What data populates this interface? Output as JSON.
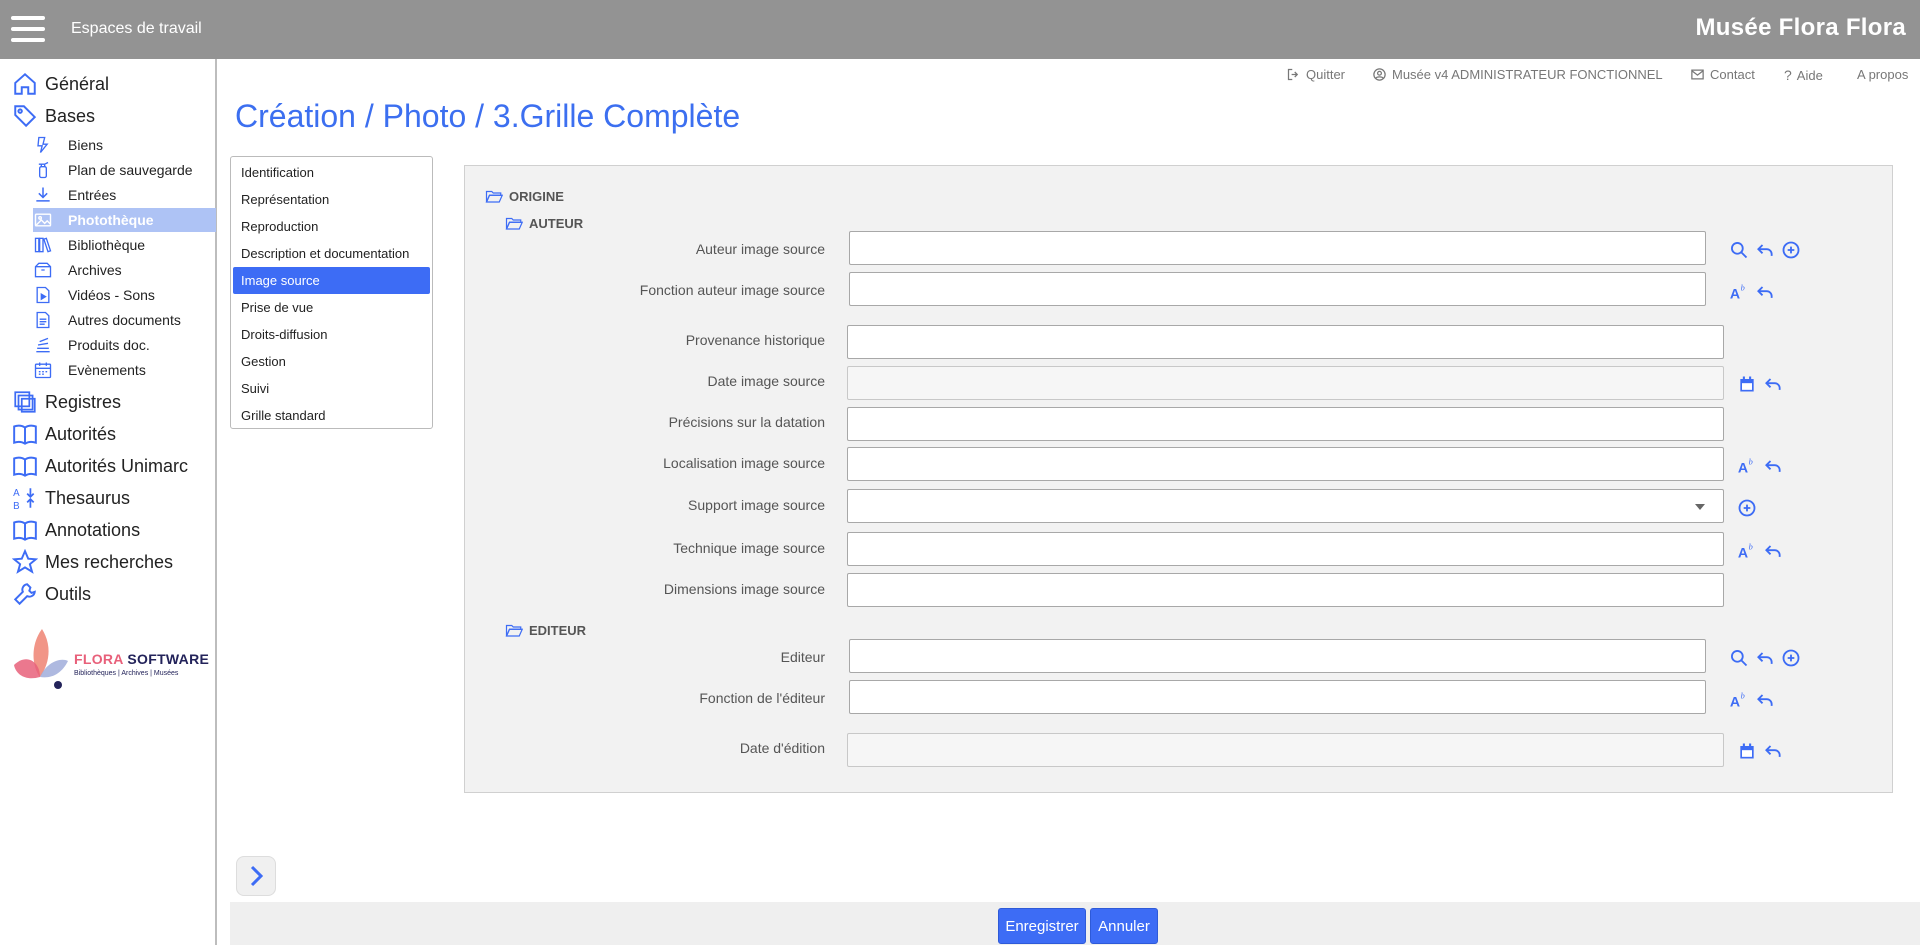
{
  "topbar": {
    "workspaces_label": "Espaces de travail",
    "museum_title": "Musée Flora Flora",
    "bg_color": "#939393"
  },
  "toplinks": {
    "quit": "Quitter",
    "user": "Musée v4 ADMINISTRATEUR FONCTIONNEL",
    "contact": "Contact",
    "help": "Aide",
    "about": "A propos"
  },
  "sidebar": {
    "main": [
      {
        "label": "Général",
        "icon": "home-icon"
      },
      {
        "label": "Bases",
        "icon": "tag-icon"
      },
      {
        "label": "Registres",
        "icon": "registers-icon"
      },
      {
        "label": "Autorités",
        "icon": "book-icon"
      },
      {
        "label": "Autorités Unimarc",
        "icon": "book-icon"
      },
      {
        "label": "Thesaurus",
        "icon": "thesaurus-icon"
      },
      {
        "label": "Annotations",
        "icon": "book-icon"
      },
      {
        "label": "Mes recherches",
        "icon": "star-icon"
      },
      {
        "label": "Outils",
        "icon": "wrench-icon"
      }
    ],
    "bases_children": [
      {
        "label": "Biens",
        "icon": "biens-icon"
      },
      {
        "label": "Plan de sauvegarde",
        "icon": "fire-extinguisher-icon"
      },
      {
        "label": "Entrées",
        "icon": "download-icon"
      },
      {
        "label": "Photothèque",
        "icon": "image-icon",
        "active": true
      },
      {
        "label": "Bibliothèque",
        "icon": "library-icon"
      },
      {
        "label": "Archives",
        "icon": "archive-box-icon"
      },
      {
        "label": "Vidéos - Sons",
        "icon": "video-file-icon"
      },
      {
        "label": "Autres documents",
        "icon": "document-icon"
      },
      {
        "label": "Produits doc.",
        "icon": "stack-icon"
      },
      {
        "label": "Evènements",
        "icon": "calendar-icon"
      }
    ],
    "logo": {
      "brand1": "FLORA",
      "brand2": " SOFTWARE",
      "tagline": "Bibliothèques | Archives | Musées"
    }
  },
  "page": {
    "title": "Création / Photo / 3.Grille Complète",
    "accent": "#3d6cf5"
  },
  "tabs": [
    {
      "label": "Identification"
    },
    {
      "label": "Représentation"
    },
    {
      "label": "Reproduction"
    },
    {
      "label": "Description et documentation"
    },
    {
      "label": "Image source",
      "active": true
    },
    {
      "label": "Prise de vue"
    },
    {
      "label": "Droits-diffusion"
    },
    {
      "label": "Gestion"
    },
    {
      "label": "Suivi"
    },
    {
      "label": "Grille standard"
    }
  ],
  "form": {
    "section_origine": "ORIGINE",
    "section_auteur": "AUTEUR",
    "section_editeur": "EDITEUR",
    "fields": {
      "auteur_image_source": {
        "label": "Auteur image source",
        "value": ""
      },
      "fonction_auteur_image_source": {
        "label": "Fonction auteur image source",
        "value": ""
      },
      "provenance_historique": {
        "label": "Provenance historique",
        "value": ""
      },
      "date_image_source": {
        "label": "Date image source",
        "value": ""
      },
      "precisions_datation": {
        "label": "Précisions sur la datation",
        "value": ""
      },
      "localisation_image_source": {
        "label": "Localisation image source",
        "value": ""
      },
      "support_image_source": {
        "label": "Support image source",
        "value": ""
      },
      "technique_image_source": {
        "label": "Technique image source",
        "value": ""
      },
      "dimensions_image_source": {
        "label": "Dimensions image source",
        "value": ""
      },
      "editeur": {
        "label": "Editeur",
        "value": ""
      },
      "fonction_editeur": {
        "label": "Fonction de l'éditeur",
        "value": ""
      },
      "date_edition": {
        "label": "Date d'édition",
        "value": ""
      }
    }
  },
  "footer": {
    "save_label": "Enregistrer",
    "cancel_label": "Annuler"
  }
}
